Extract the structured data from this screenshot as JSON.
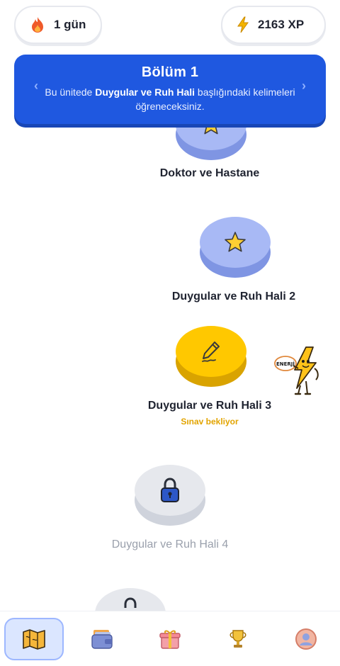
{
  "header": {
    "streak": {
      "icon": "flame-icon",
      "label": "1 gün"
    },
    "xp": {
      "icon": "lightning-icon",
      "label": "2163 XP"
    }
  },
  "unit": {
    "title": "Bölüm 1",
    "desc_prefix": "Bu ünitede ",
    "desc_bold": "Duygular ve Ruh Hali",
    "desc_suffix": " başlığındaki kelimeleri öğreneceksiniz.",
    "prev_label": "‹",
    "next_label": "›"
  },
  "lessons": [
    {
      "title": "Doktor ve Hastane",
      "state": "completed",
      "icon": "star-icon"
    },
    {
      "title": "Duygular ve Ruh Hali 2",
      "state": "completed",
      "icon": "star-icon"
    },
    {
      "title": "Duygular ve Ruh Hali 3",
      "state": "active",
      "icon": "pencil-icon",
      "status": "Sınav bekliyor"
    },
    {
      "title": "Duygular ve Ruh Hali 4",
      "state": "locked",
      "icon": "lock-icon"
    },
    {
      "title": "",
      "state": "locked",
      "icon": "lock-icon"
    }
  ],
  "mascot": {
    "icon": "energy-mascot-icon",
    "label": "ENERJİ"
  },
  "nav": [
    {
      "icon": "map-icon",
      "active": true
    },
    {
      "icon": "wallet-icon",
      "active": false
    },
    {
      "icon": "gift-icon",
      "active": false
    },
    {
      "icon": "trophy-icon",
      "active": false
    },
    {
      "icon": "profile-icon",
      "active": false
    }
  ],
  "colors": {
    "accent_blue": "#1f58e0",
    "active_yellow": "#ffc800",
    "completed_blue": "#a8b9f5",
    "locked_gray": "#e6e8ed",
    "status_text": "#e2a400"
  }
}
